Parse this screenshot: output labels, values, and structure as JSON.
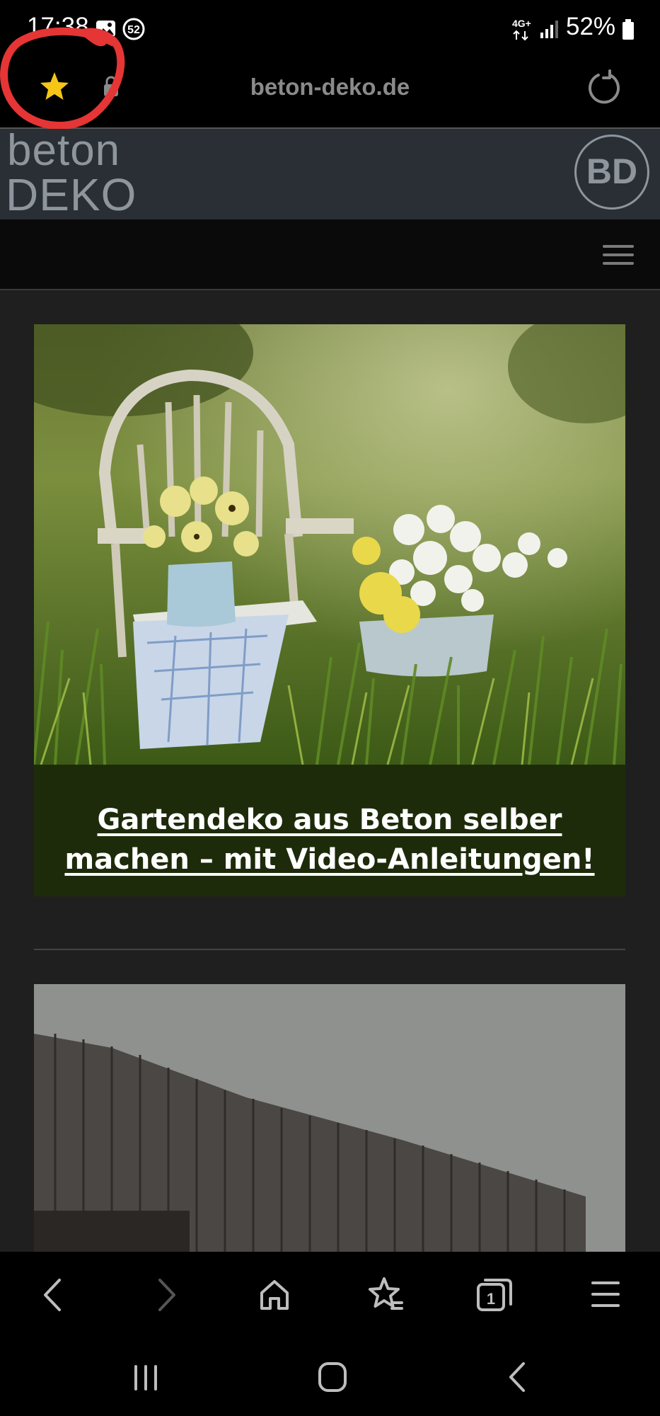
{
  "status_bar": {
    "time": "17:38",
    "notification_count": "52",
    "network": "4G+",
    "battery": "52%"
  },
  "browser": {
    "url": "beton-deko.de"
  },
  "site": {
    "logo_line1": "beton",
    "logo_line2": "DEKO",
    "badge_text": "BD"
  },
  "content": {
    "card1_title": "Gartendeko aus Beton selber machen – mit Video-Anleitungen!"
  },
  "toolbar": {
    "tabs_count": "1"
  },
  "colors": {
    "star": "#f5c518",
    "annotation": "#e53535",
    "caption_bg": "#1e2b0b"
  }
}
